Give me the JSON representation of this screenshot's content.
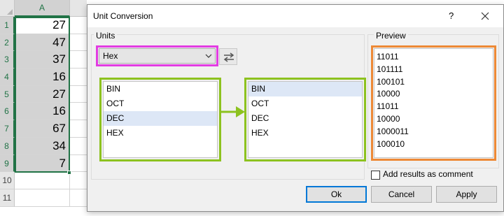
{
  "spreadsheet": {
    "column_header": "A",
    "row_numbers": [
      "1",
      "2",
      "3",
      "4",
      "5",
      "6",
      "7",
      "8",
      "9",
      "10",
      "11"
    ],
    "values": [
      "27",
      "47",
      "37",
      "16",
      "27",
      "16",
      "67",
      "34",
      "7"
    ]
  },
  "dialog": {
    "title": "Unit Conversion",
    "help_label": "?",
    "units_group_label": "Units",
    "unit_select_value": "Hex",
    "from_units": [
      "BIN",
      "OCT",
      "DEC",
      "HEX"
    ],
    "from_selected": "DEC",
    "to_units": [
      "BIN",
      "OCT",
      "DEC",
      "HEX"
    ],
    "to_selected": "BIN",
    "preview_label": "Preview",
    "preview_values": [
      "11011",
      "101111",
      "100101",
      "10000",
      "11011",
      "10000",
      "1000011",
      "100010"
    ],
    "add_comment_label": "Add results as comment",
    "add_comment_checked": false,
    "ok_label": "Ok",
    "cancel_label": "Cancel",
    "apply_label": "Apply"
  },
  "colors": {
    "excel_green": "#217346",
    "highlight_magenta": "#e23ce2",
    "highlight_green": "#8dc21f",
    "highlight_orange": "#ed8936",
    "focus_blue": "#0078d7"
  }
}
